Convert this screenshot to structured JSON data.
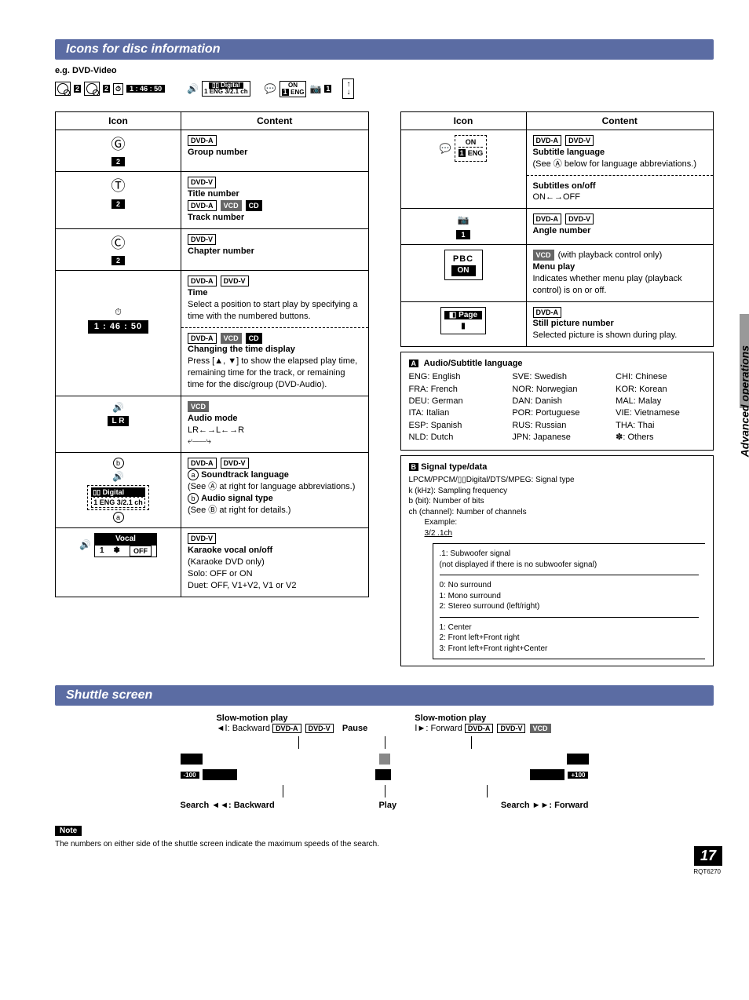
{
  "section1_title": "Icons for disc information",
  "eg_label": "e.g. DVD-Video",
  "osd": {
    "title_num": "2",
    "chapter_num": "2",
    "time": "1 : 46 : 50",
    "audio": "Digital",
    "audio_line2": "1 ENG 3/2.1 ch",
    "sub_on": "ON",
    "sub_lang_num": "1",
    "sub_lang": "ENG",
    "angle": "1"
  },
  "left_table": {
    "head_icon": "Icon",
    "head_content": "Content",
    "row1": {
      "num": "2",
      "badges": [
        "DVD-A"
      ],
      "title": "Group number"
    },
    "row2": {
      "num": "2",
      "badges1": [
        "DVD-V"
      ],
      "title1": "Title number",
      "badges2": [
        "DVD-A",
        "VCD",
        "CD"
      ],
      "title2": "Track number"
    },
    "row3": {
      "num": "2",
      "badges": [
        "DVD-V"
      ],
      "title": "Chapter number"
    },
    "row4": {
      "time": "1 : 46 : 50",
      "badges1": [
        "DVD-A",
        "DVD-V"
      ],
      "title1": "Time",
      "desc1": "Select a position to start play by specifying a time with the numbered buttons.",
      "badges2": [
        "DVD-A",
        "VCD",
        "CD"
      ],
      "title2": "Changing the time display",
      "desc2": "Press [▲, ▼] to show the elapsed play time, remaining time for the track, or remaining time for the disc/group (DVD-Audio)."
    },
    "row5": {
      "lr": "L R",
      "badges": [
        "VCD"
      ],
      "title": "Audio mode",
      "desc": "LR←→L←→R"
    },
    "row6": {
      "dig1": "Digital",
      "dig2": "1 ENG 3/2.1 ch",
      "marker_a": "a",
      "marker_b": "b",
      "badges": [
        "DVD-A",
        "DVD-V"
      ],
      "line_a_t": "Soundtrack language",
      "line_a_d": "(See Ⓐ at right for language abbreviations.)",
      "line_b_t": "Audio signal type",
      "line_b_d": "(See Ⓑ at right for details.)"
    },
    "row7": {
      "vocal": "Vocal",
      "one": "1",
      "star": "✽",
      "off": "OFF",
      "badges": [
        "DVD-V"
      ],
      "title": "Karaoke vocal on/off",
      "d1": "(Karaoke DVD only)",
      "d2": "Solo: OFF or ON",
      "d3": "Duet: OFF, V1+V2, V1 or V2"
    }
  },
  "right_table": {
    "head_icon": "Icon",
    "head_content": "Content",
    "row1": {
      "on": "ON",
      "num": "1",
      "eng": "ENG",
      "badges": [
        "DVD-A",
        "DVD-V"
      ],
      "t1": "Subtitle language",
      "d1": "(See Ⓐ below for language abbreviations.)",
      "t2": "Subtitles on/off",
      "d2": "ON←→OFF"
    },
    "row2": {
      "num": "1",
      "badges": [
        "DVD-A",
        "DVD-V"
      ],
      "t": "Angle number"
    },
    "row3": {
      "pbc": "PBC",
      "on": "ON",
      "badge": "VCD",
      "extra": "(with playback control only)",
      "t": "Menu play",
      "d": "Indicates whether menu play (playback control) is on or off."
    },
    "row4": {
      "page": "Page",
      "pg_icon": "1",
      "badge": "DVD-A",
      "t": "Still picture number",
      "d": "Selected picture is shown during play."
    }
  },
  "lang": {
    "label_letter": "A",
    "title": "Audio/Subtitle language",
    "col1": [
      "ENG: English",
      "FRA: French",
      "DEU: German",
      "ITA: Italian",
      "ESP: Spanish",
      "NLD: Dutch"
    ],
    "col2": [
      "SVE: Swedish",
      "NOR: Norwegian",
      "DAN: Danish",
      "POR: Portuguese",
      "RUS: Russian",
      "JPN: Japanese"
    ],
    "col3": [
      "CHI: Chinese",
      "KOR: Korean",
      "MAL: Malay",
      "VIE: Vietnamese",
      "THA: Thai",
      "✽: Others"
    ]
  },
  "signal": {
    "label_letter": "B",
    "title": "Signal type/data",
    "l1": "LPCM/PPCM/▯▯Digital/DTS/MPEG: Signal type",
    "l2": "k (kHz): Sampling frequency",
    "l3": "b (bit): Number of bits",
    "l4": "ch (channel): Number of channels",
    "ex": "Example:",
    "ex_val": "3/2 .1ch",
    "g1": ".1: Subwoofer signal\n(not displayed if there is no subwoofer signal)",
    "g2": "0: No surround\n1: Mono surround\n2: Stereo surround (left/right)",
    "g3": "1: Center\n2: Front left+Front right\n3: Front left+Front right+Center"
  },
  "section2_title": "Shuttle screen",
  "shuttle": {
    "slow_l_t": "Slow-motion play",
    "slow_l_d": "◄Ⅰ: Backward",
    "slow_l_badges": [
      "DVD-A",
      "DVD-V"
    ],
    "pause": "Pause",
    "slow_r_t": "Slow-motion play",
    "slow_r_d": "Ⅰ►: Forward",
    "slow_r_badges": [
      "DVD-A",
      "DVD-V",
      "VCD"
    ],
    "minus100": "-100",
    "plus100": "+100",
    "search_l": "Search ◄◄: Backward",
    "play": "Play",
    "search_r": "Search ►►: Forward"
  },
  "note_label": "Note",
  "note_text": "The numbers on either side of the shuttle screen indicate the maximum speeds of the search.",
  "side_text": "Advanced operations",
  "page_num": "17",
  "page_code": "RQT6270"
}
